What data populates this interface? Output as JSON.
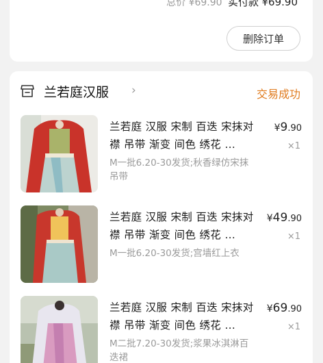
{
  "top_card": {
    "total_label": "总价",
    "total_value": "¥69.90",
    "paid_label": "实付款",
    "paid_value": "¥69.90",
    "delete_label": "删除订单"
  },
  "order": {
    "shop_name": "兰若庭汉服",
    "status": "交易成功",
    "items": [
      {
        "title": "兰若庭 汉服 宋制 百迭 宋抹对襟 吊带 渐变 间色 绣花 …",
        "sku": "M一批6.20-30发货;秋香绿仿宋抹吊带",
        "price_symbol": "¥",
        "price_int": "9",
        "price_dec": ".90",
        "qty": "×1"
      },
      {
        "title": "兰若庭 汉服 宋制 百迭 宋抹对襟 吊带 渐变 间色 绣花 …",
        "sku": "M一批6.20-30发货;宫墙红上衣",
        "price_symbol": "¥",
        "price_int": "49",
        "price_dec": ".90",
        "qty": "×1"
      },
      {
        "title": "兰若庭 汉服 宋制 百迭 宋抹对襟 吊带 渐变 间色 绣花 …",
        "sku": "M二批7.20-30发货;浆果冰淇淋百迭裙",
        "price_symbol": "¥",
        "price_int": "69",
        "price_dec": ".90",
        "qty": "×1"
      }
    ]
  },
  "colors": {
    "status": "#e07b1e",
    "background": "#f2f2f2",
    "card": "#ffffff"
  },
  "icons": {
    "shop": "store-icon",
    "chevron": "chevron-right-icon"
  }
}
